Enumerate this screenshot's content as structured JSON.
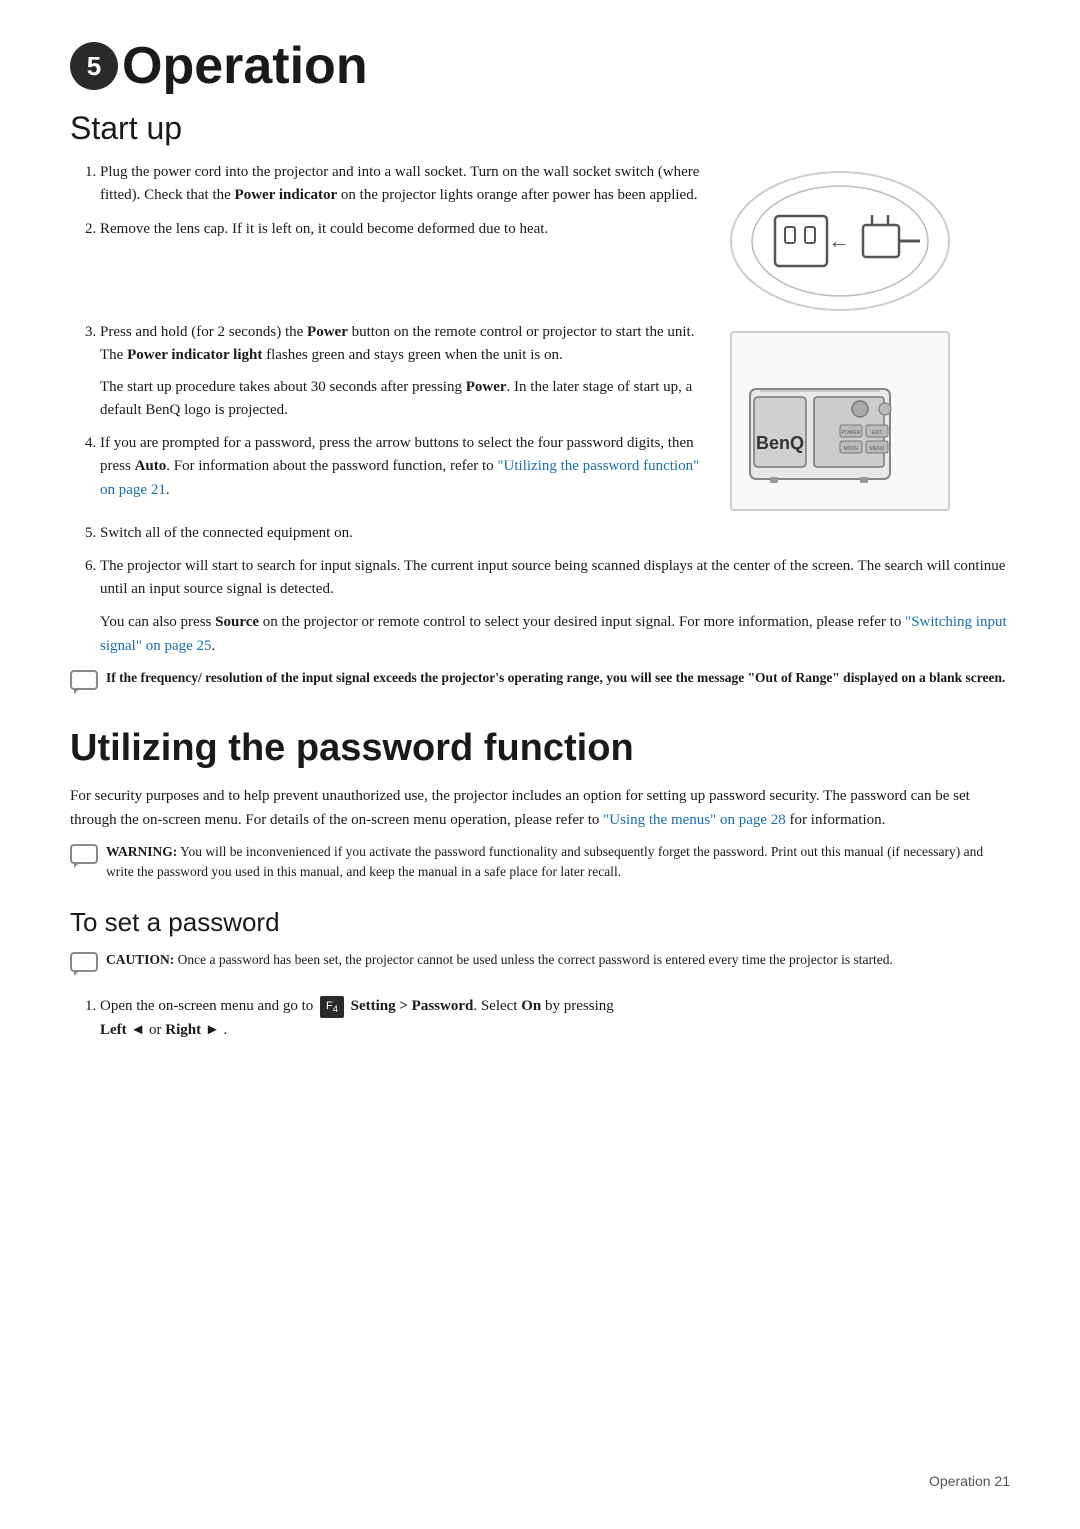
{
  "chapter": {
    "number": "5",
    "title": "Operation"
  },
  "startup": {
    "section_title": "Start up",
    "steps": [
      {
        "id": 1,
        "text": "Plug the power cord into the projector and into a wall socket. Turn on the wall socket switch (where fitted). Check that the ",
        "bold_part": "Power indicator",
        "text_after": " on the projector lights orange after power has been applied."
      },
      {
        "id": 2,
        "text": "Remove the lens cap. If it is left on, it could become deformed due to heat."
      },
      {
        "id": 3,
        "text": "Press and hold (for 2 seconds) the ",
        "bold1": "Power",
        "text2": " button on the remote control or projector to start the unit. The ",
        "bold2": "Power indicator light",
        "text3": " flashes green and stays green when the unit is on.",
        "extra": "The start up procedure takes about 30 seconds after pressing ",
        "bold3": "Power",
        "extra2": ". In the later stage of start up, a default BenQ logo is projected."
      },
      {
        "id": 4,
        "text": "If you are prompted for a password, press the arrow buttons to select the four password digits, then press ",
        "bold": "Auto",
        "text_after": ". For information about the password function, refer to ",
        "link_text": "\"Utilizing the password function\" on page 21",
        "text_end": "."
      },
      {
        "id": 5,
        "text": "Switch all of the connected equipment on."
      },
      {
        "id": 6,
        "text": "The projector will start to search for input signals. The current input source being scanned displays at the center of the screen. The search will continue until an input source signal is detected.",
        "extra_para": "You can also press ",
        "bold_source": "Source",
        "extra_para2": " on the projector or remote control to select your desired input signal. For more information, please refer to ",
        "link_text": "\"Switching input signal\" on page 25",
        "extra_end": "."
      }
    ],
    "note": {
      "text": "If the frequency/ resolution of the input signal exceeds the projector's operating range, you will see the message “Out of Range” displayed on a blank screen."
    }
  },
  "password_section": {
    "title": "Utilizing the password function",
    "intro": "For security purposes and to help prevent unauthorized use, the projector includes an option for setting up password security. The password can be set through the on-screen menu. For details of the on-screen menu operation, please refer to ",
    "link_text": "\"Using the menus\" on page 28",
    "intro_end": " for information.",
    "warning": {
      "label": "WARNING:",
      "text": " You will be inconvenienced if you activate the password functionality and subsequently forget the password. Print out this manual (if necessary) and write the password you used in this manual, and keep the manual in a safe place for later recall."
    },
    "subsection": {
      "title": "To set a password",
      "caution": {
        "label": "CAUTION:",
        "text": " Once a password has been set, the projector cannot be used unless the correct password is entered every time the projector is started."
      },
      "steps": [
        {
          "id": 1,
          "text_before": "Open the on-screen menu and go to ",
          "icon_label": "F4",
          "text_middle": " Setting > Password. Select On by pressing Left ",
          "arrow_left": "◄",
          "text_or": " or Right ",
          "arrow_right": "►",
          "text_end": " ."
        }
      ]
    }
  },
  "footer": {
    "text": "Operation",
    "page_number": "21"
  }
}
